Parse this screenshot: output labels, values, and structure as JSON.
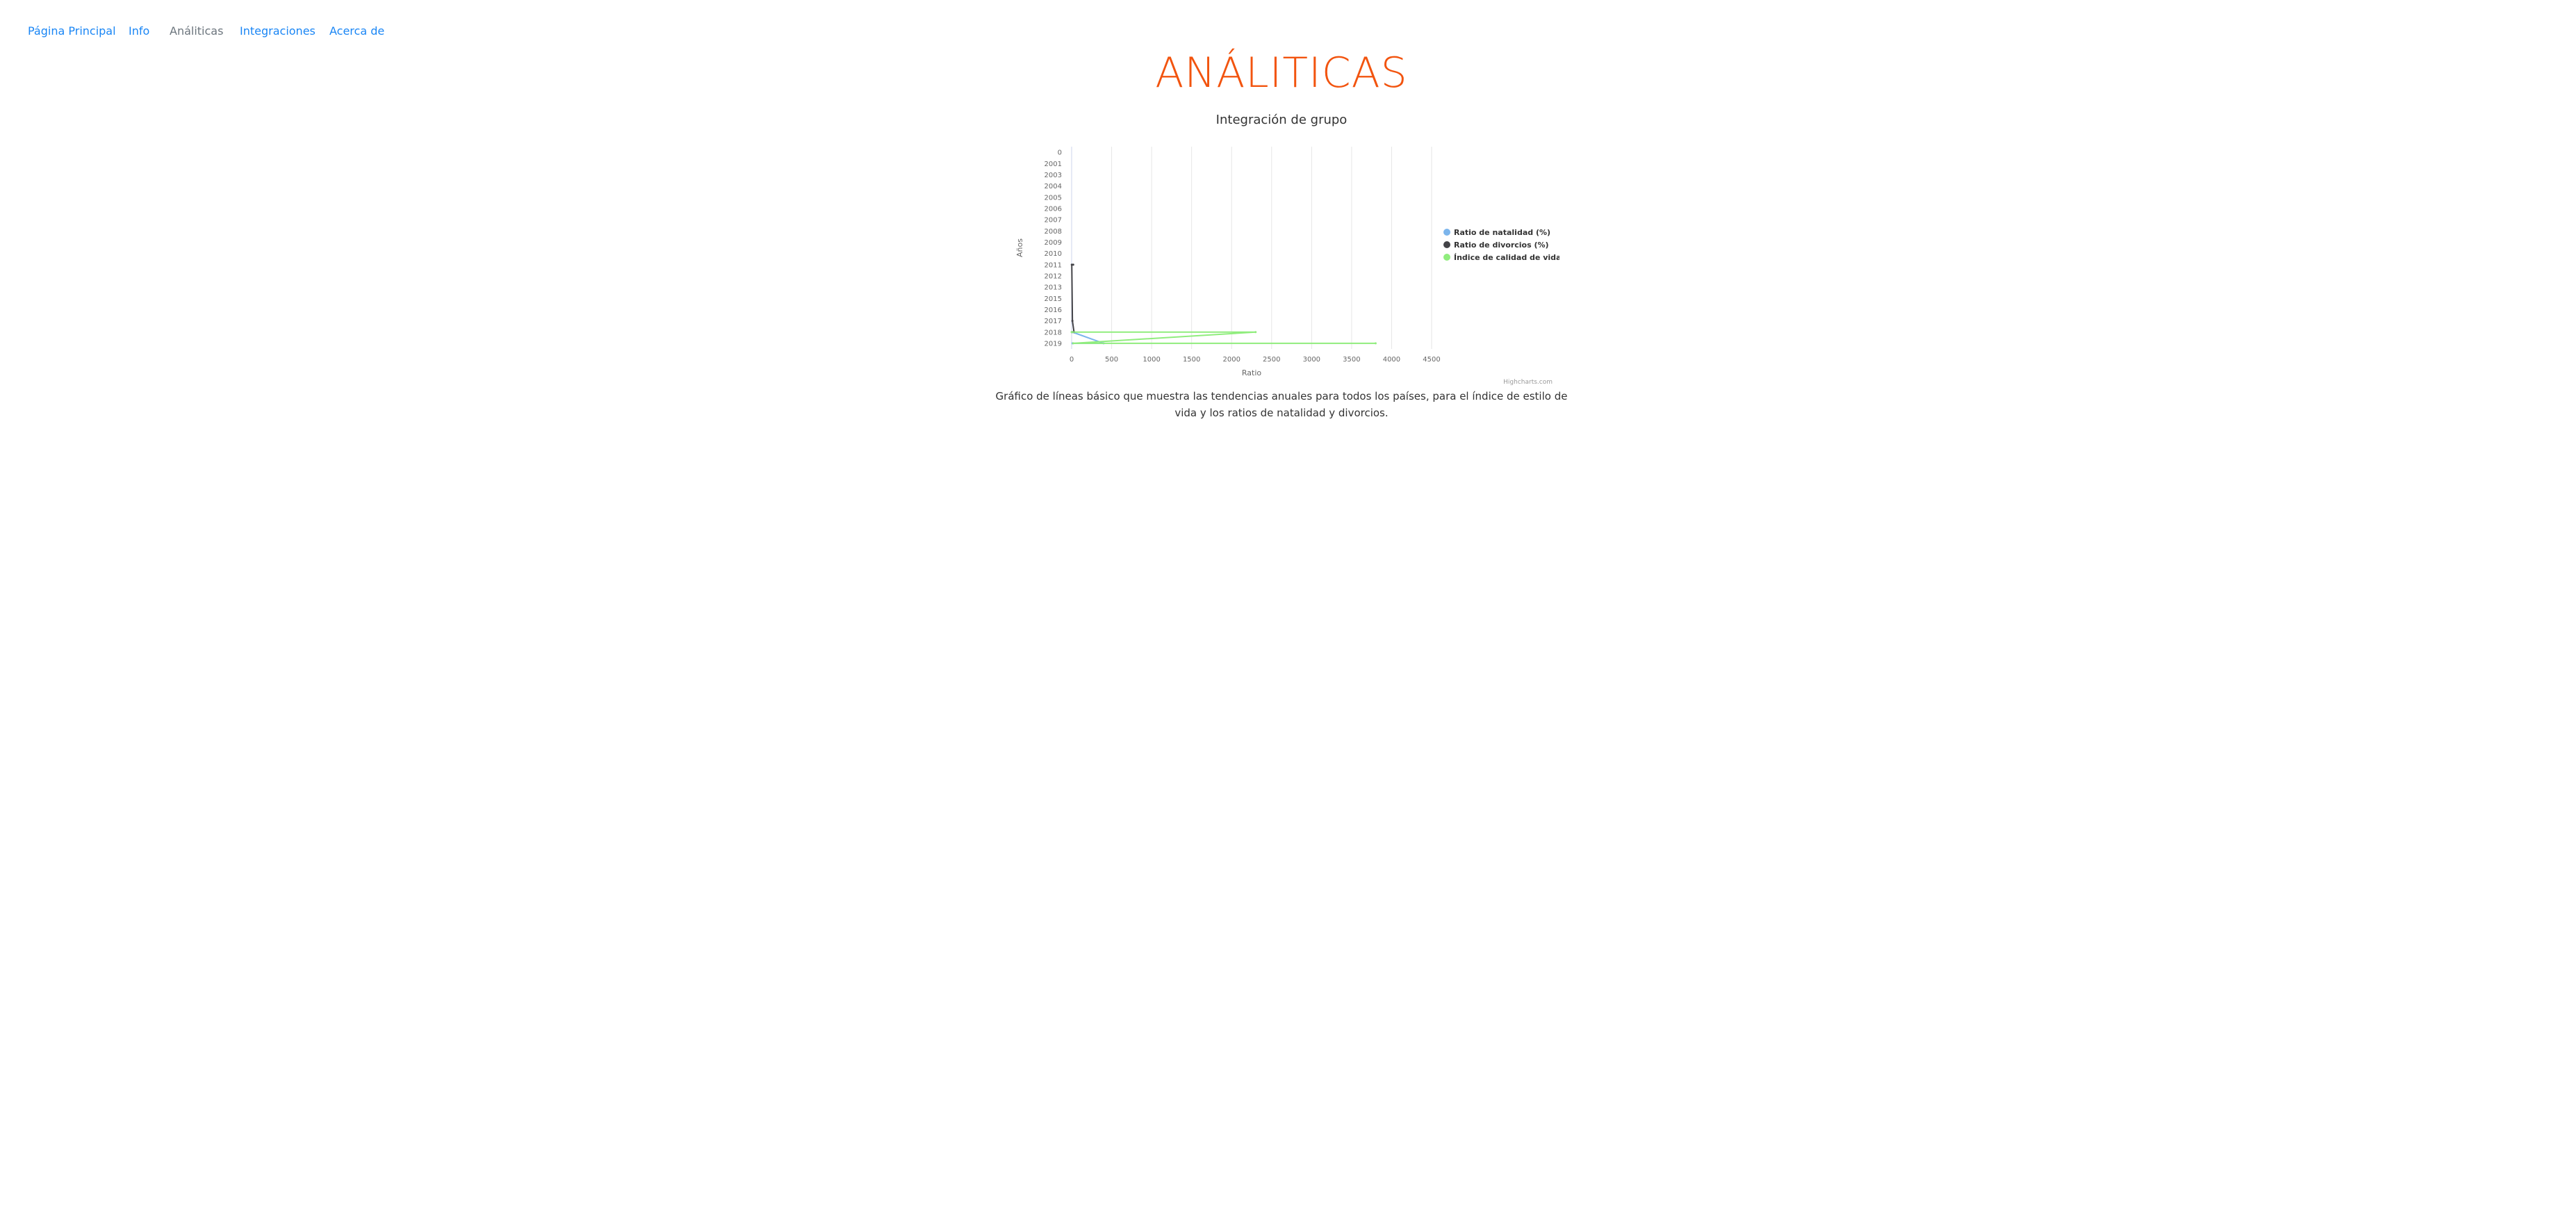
{
  "nav": {
    "items": [
      {
        "label": "Página Principal",
        "active": false
      },
      {
        "label": "Info",
        "active": false
      },
      {
        "label": "Análiticas",
        "active": true
      },
      {
        "label": "Integraciones",
        "active": false
      },
      {
        "label": "Acerca de",
        "active": false
      }
    ]
  },
  "page": {
    "title": "ANÁLITICAS",
    "caption": "Gráfico de líneas básico que muestra las tendencias anuales para todos los países, para el índice de estilo de vida y los ratios de natalidad y divorcios."
  },
  "colors": {
    "nav_link": "#1a86f5",
    "nav_active": "#6c757d",
    "title": "#f2540f",
    "series_natalidad": "#7cb5ec",
    "series_divorcios": "#434348",
    "series_calidad": "#90ed7d"
  },
  "chart_data": {
    "type": "line",
    "title": "Integración de grupo",
    "xlabel": "Ratio",
    "ylabel": "Años",
    "credits": "Highcharts.com",
    "legend_position": "right",
    "grid": true,
    "x_ticks": [
      0,
      500,
      1000,
      1500,
      2000,
      2500,
      3000,
      3500,
      4000,
      4500
    ],
    "xlim": [
      0,
      4500
    ],
    "categories": [
      "0",
      "2001",
      "2003",
      "2004",
      "2005",
      "2006",
      "2007",
      "2008",
      "2009",
      "2010",
      "2011",
      "2012",
      "2013",
      "2015",
      "2016",
      "2017",
      "2018",
      "2019"
    ],
    "series": [
      {
        "name": "Ratio de natalidad (%)",
        "points": [
          {
            "y": "2018",
            "x": 10
          },
          {
            "y": "2019",
            "x": 400
          },
          {
            "y": "2019",
            "x": 10
          }
        ]
      },
      {
        "name": "Ratio de divorcios (%)",
        "points": [
          {
            "y": "2011",
            "x": 20
          },
          {
            "y": "2011",
            "x": 2
          },
          {
            "y": "2017",
            "x": 10
          },
          {
            "y": "2018",
            "x": 30
          },
          {
            "y": "2018",
            "x": 5
          }
        ]
      },
      {
        "name": "Índice de calidad de vida",
        "points": [
          {
            "y": "2018",
            "x": 0
          },
          {
            "y": "2018",
            "x": 2300
          },
          {
            "y": "2019",
            "x": 20
          },
          {
            "y": "2019",
            "x": 3800
          }
        ]
      }
    ]
  }
}
